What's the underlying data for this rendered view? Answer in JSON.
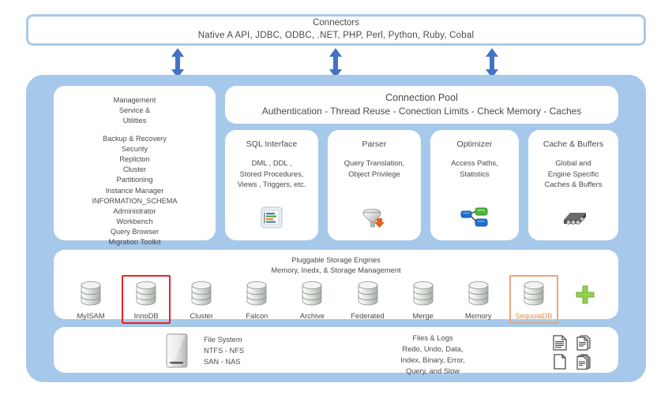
{
  "connectors": {
    "title": "Connectors",
    "list": "Native A API,  JDBC,  ODBC,  .NET,  PHP,  Perl,  Python,  Ruby,  Cobal"
  },
  "management": {
    "title_line1": "Management",
    "title_line2": "Service &",
    "title_line3": "Utilities",
    "items": [
      "Backup & Recovery",
      "Security",
      "Replicton",
      "Cluster",
      "Partitioning",
      "Instance Manager",
      "INFORMATION_SCHEMA",
      "Administrator",
      "Workbench",
      "Query Browser",
      "Migration Toolkit"
    ]
  },
  "connection_pool": {
    "title": "Connection Pool",
    "subtitle": "Authentication - Thread Reuse - Conection Limits - Check Memory - Caches"
  },
  "features": [
    {
      "id": "sql-interface",
      "title": "SQL Interface",
      "body_lines": [
        "DML , DDL ,",
        "Stored Procedures,",
        "Views , Triggers, etc."
      ],
      "icon": "sql-document-icon"
    },
    {
      "id": "parser",
      "title": "Parser",
      "body_lines": [
        "Query Translation,",
        "Object Privilege"
      ],
      "icon": "funnel-icon"
    },
    {
      "id": "optimizer",
      "title": "Optimizer",
      "body_lines": [
        "Access Paths,",
        "Statistics"
      ],
      "icon": "node-graph-icon"
    },
    {
      "id": "cache-buffers",
      "title": "Cache & Buffers",
      "body_lines": [
        "Global and",
        "Engine Specific",
        "Caches & Buffers"
      ],
      "icon": "memory-chip-icon"
    }
  ],
  "storage": {
    "title": "Pluggable Storage Engines",
    "subtitle": "Memory, Inedx, & Storage Management",
    "engines": [
      {
        "label": "MyISAM",
        "highlight": "none"
      },
      {
        "label": "InnoDB",
        "highlight": "red"
      },
      {
        "label": "Cluster",
        "highlight": "none"
      },
      {
        "label": "Falcon",
        "highlight": "none"
      },
      {
        "label": "Archive",
        "highlight": "none"
      },
      {
        "label": "Federated",
        "highlight": "none"
      },
      {
        "label": "Merge",
        "highlight": "none"
      },
      {
        "label": "Memory",
        "highlight": "none"
      },
      {
        "label": "SequoiaDB",
        "highlight": "orange"
      }
    ],
    "add_icon": "plus-icon"
  },
  "filesystem": {
    "drive_icon": "hard-drive-icon",
    "fs_line1": "File System",
    "fs_line2": "NTFS - NFS",
    "fs_line3": "SAN - NAS",
    "logs_title": "Files &  Logs",
    "logs_line1": "Redo, Undo, Data,",
    "logs_line2": "Index, Binary, Error,",
    "logs_line3": "Query, and Slow",
    "log_icons": [
      "file-lines-icon",
      "file-copy-icon",
      "file-blank-icon",
      "file-stack-icon"
    ]
  },
  "arrows": {
    "icon": "double-arrow-vertical-icon",
    "count": 3
  },
  "colors": {
    "container_blue": "#a6c8ea",
    "connector_border": "#a8c9e8",
    "arrow_blue": "#4472c4",
    "highlight_red": "#ee2020",
    "highlight_orange": "#e8a87c",
    "sequoia_text": "#e08a45",
    "plus_green": "#92d050"
  }
}
